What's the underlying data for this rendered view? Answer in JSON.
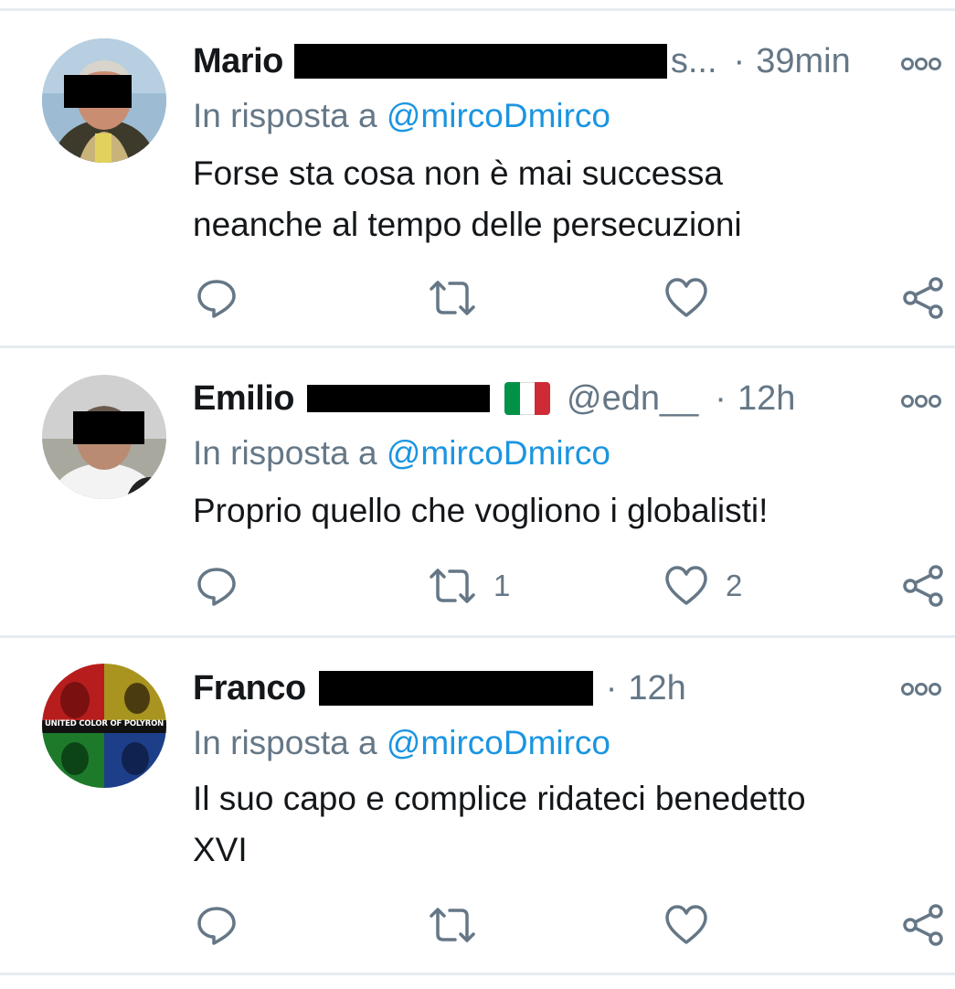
{
  "tweets": [
    {
      "name": "Mario",
      "handle_tail": "s...",
      "handle": "",
      "flag": false,
      "time": "39min",
      "reply_prefix": "In risposta a",
      "reply_to": "@mircoDmirco",
      "text_lines": [
        "Forse sta cosa non è mai successa",
        "neanche al tempo delle persecuzioni"
      ],
      "retweets": "",
      "likes": "",
      "avatar_icon": "profile-photo-man"
    },
    {
      "name": "Emilio",
      "handle_tail": "",
      "handle": "@edn__",
      "flag": true,
      "time": "12h",
      "reply_prefix": "In risposta a",
      "reply_to": "@mircoDmirco",
      "text_lines": [
        "Proprio quello che vogliono i globalisti!"
      ],
      "retweets": "1",
      "likes": "2",
      "avatar_icon": "profile-photo-man"
    },
    {
      "name": "Franco",
      "handle_tail": "",
      "handle": "",
      "flag": false,
      "time": "12h",
      "reply_prefix": "In risposta a",
      "reply_to": "@mircoDmirco",
      "text_lines": [
        "Il suo capo e complice ridateci benedetto",
        "XVI"
      ],
      "retweets": "",
      "likes": "",
      "avatar_icon": "collage-avatar",
      "avatar_caption": "UNITED COLOR OF POLYRON"
    }
  ],
  "separator": "·",
  "colors": {
    "text": "#14171a",
    "muted": "#657786",
    "link": "#1b95e0",
    "divider": "#e6ecf0"
  },
  "icons": {
    "reply": "comment-icon",
    "retweet": "retweet-icon",
    "like": "heart-icon",
    "share": "share-icon",
    "more": "more-options-icon"
  }
}
